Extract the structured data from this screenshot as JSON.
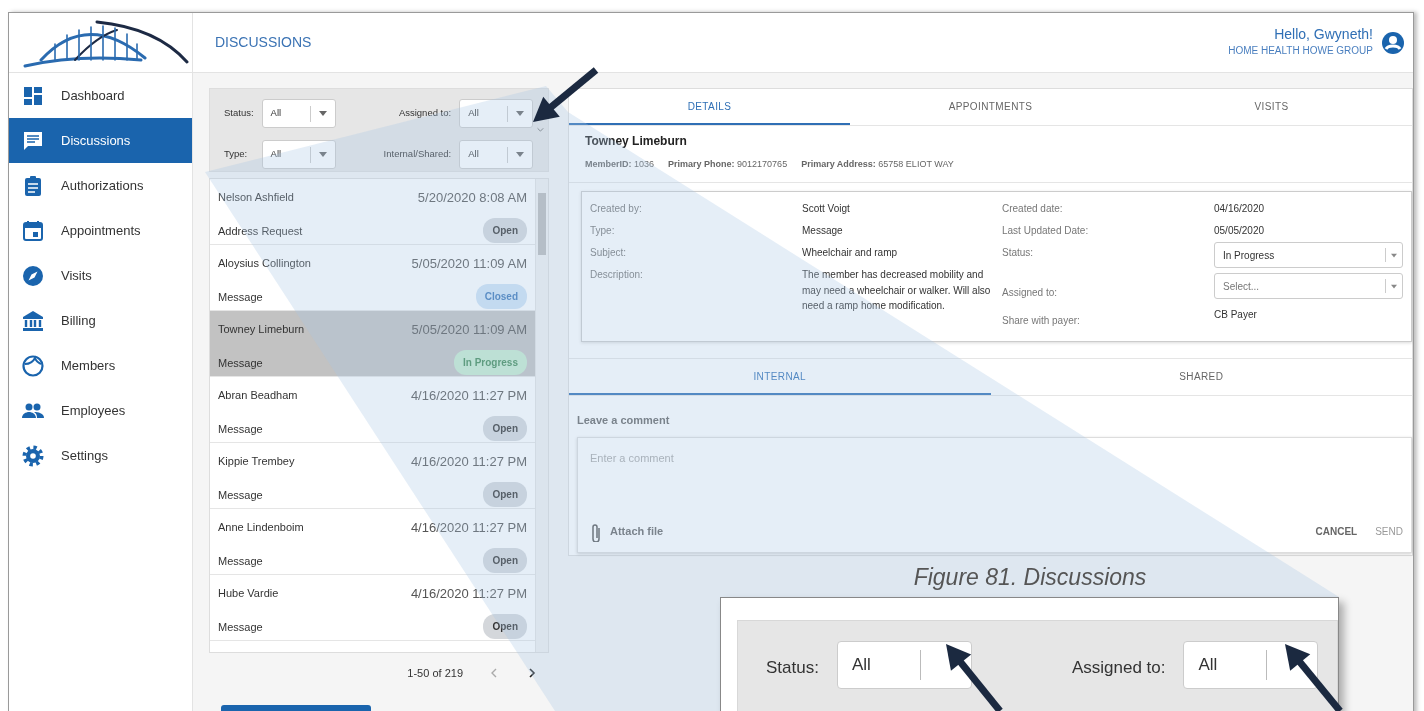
{
  "header": {
    "title": "DISCUSSIONS",
    "greeting": "Hello, Gwyneth!",
    "organization": "HOME HEALTH HOWE GROUP"
  },
  "sidebar": {
    "items": [
      {
        "label": "Dashboard",
        "selected": false
      },
      {
        "label": "Discussions",
        "selected": true
      },
      {
        "label": "Authorizations",
        "selected": false
      },
      {
        "label": "Appointments",
        "selected": false
      },
      {
        "label": "Visits",
        "selected": false
      },
      {
        "label": "Billing",
        "selected": false
      },
      {
        "label": "Members",
        "selected": false
      },
      {
        "label": "Employees",
        "selected": false
      },
      {
        "label": "Settings",
        "selected": false
      }
    ]
  },
  "filters": [
    {
      "label": "Status:",
      "value": "All"
    },
    {
      "label": "Assigned to:",
      "value": "All"
    },
    {
      "label": "Type:",
      "value": "All"
    },
    {
      "label": "Internal/Shared:",
      "value": "All"
    }
  ],
  "discussions": [
    {
      "name": "Nelson Ashfield",
      "date": "5/20/2020 8:08 AM",
      "type": "Address Request",
      "status": "Open",
      "kind": "open",
      "selected": false
    },
    {
      "name": "Aloysius Collington",
      "date": "5/05/2020 11:09 AM",
      "type": "Message",
      "status": "Closed",
      "kind": "closed",
      "selected": false
    },
    {
      "name": "Towney Limeburn",
      "date": "5/05/2020 11:09 AM",
      "type": "Message",
      "status": "In Progress",
      "kind": "progress",
      "selected": true
    },
    {
      "name": "Abran Beadham",
      "date": "4/16/2020 11:27 PM",
      "type": "Message",
      "status": "Open",
      "kind": "open",
      "selected": false
    },
    {
      "name": "Kippie Trembey",
      "date": "4/16/2020 11:27 PM",
      "type": "Message",
      "status": "Open",
      "kind": "open",
      "selected": false
    },
    {
      "name": "Anne Lindenboim",
      "date": "4/16/2020 11:27 PM",
      "type": "Message",
      "status": "Open",
      "kind": "open",
      "selected": false
    },
    {
      "name": "Hube Vardie",
      "date": "4/16/2020 11:27 PM",
      "type": "Message",
      "status": "Open",
      "kind": "open",
      "selected": false
    }
  ],
  "pagination": {
    "range": "1-50 of 219"
  },
  "detail_tabs": [
    {
      "label": "DETAILS",
      "selected": true
    },
    {
      "label": "APPOINTMENTS",
      "selected": false
    },
    {
      "label": "VISITS",
      "selected": false
    }
  ],
  "member": {
    "name": "Towney Limeburn",
    "fields": [
      {
        "label": "MemberID:",
        "value": "1036"
      },
      {
        "label": "Primary Phone:",
        "value": "9012170765"
      },
      {
        "label": "Primary Address:",
        "value": "65758 ELIOT WAY"
      }
    ]
  },
  "details": {
    "left": [
      {
        "label": "Created by:",
        "value": "Scott Voigt"
      },
      {
        "label": "Type:",
        "value": "Message"
      },
      {
        "label": "Subject:",
        "value": "Wheelchair and ramp"
      },
      {
        "label": "Description:",
        "value": "The member has decreased mobility and may need a wheelchair or walker. Will also need a ramp home modification."
      }
    ],
    "right": [
      {
        "label": "Created date:",
        "kind": "text",
        "value": "04/16/2020"
      },
      {
        "label": "Last Updated Date:",
        "kind": "text",
        "value": "05/05/2020"
      },
      {
        "label": "Status:",
        "kind": "select",
        "value": "In Progress"
      },
      {
        "label": "Assigned to:",
        "kind": "select",
        "placeholder": "Select..."
      },
      {
        "label": "Share with payer:",
        "kind": "text",
        "value": "CB Payer"
      }
    ]
  },
  "comment_tabs": [
    {
      "label": "INTERNAL",
      "selected": true
    },
    {
      "label": "SHARED",
      "selected": false
    }
  ],
  "comment": {
    "heading": "Leave a comment",
    "placeholder": "Enter a comment",
    "attach": "Attach file",
    "buttons": [
      {
        "label": "CANCEL",
        "disabled": false
      },
      {
        "label": "SEND",
        "disabled": true
      }
    ]
  },
  "caption": "Figure 81. Discussions",
  "callout": {
    "filters": [
      {
        "label": "Status:",
        "value": "All"
      },
      {
        "label": "Assigned to:",
        "value": "All"
      }
    ]
  }
}
